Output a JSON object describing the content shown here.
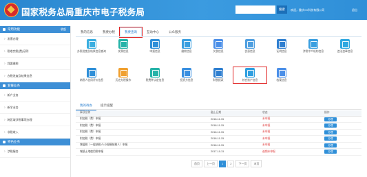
{
  "header": {
    "title": "国家税务总局重庆市电子税务局",
    "search_placeholder": "",
    "search_button": "搜索",
    "welcome": "欢迎，重庆XX科技有限公司",
    "logout": "退出"
  },
  "sidebar": {
    "groups": [
      {
        "label": "常用功能",
        "action": "收起",
        "items": [
          "发票办理",
          "税收完税(费)证明",
          "我要缴税",
          "办税进度及结果信息"
        ]
      },
      {
        "label": "套餐业务",
        "action": "",
        "items": [
          "新户业务",
          "新学业务",
          "跨区域涉税事项办理",
          "非税收入"
        ]
      },
      {
        "label": "特色业务",
        "action": "",
        "items": [
          "涉税服务"
        ]
      }
    ]
  },
  "topnav": {
    "tabs": [
      "我的信息",
      "我要办税",
      "我要查询",
      "互动中心",
      "公众服务"
    ],
    "active_index": 2
  },
  "grid": {
    "items": [
      {
        "label": "办税进度及结果信息查询",
        "color": "#3aaee0"
      },
      {
        "label": "发票信息",
        "color": "#26b3a8"
      },
      {
        "label": "申报信息",
        "color": "#2f8fd8"
      },
      {
        "label": "缴款信息",
        "color": "#3a9fe0"
      },
      {
        "label": "欠税信息",
        "color": "#4b8fe8"
      },
      {
        "label": "优惠信息",
        "color": "#4f9fe0"
      },
      {
        "label": "证明信息",
        "color": "#2f7fd0"
      },
      {
        "label": "涉税中介机构信息",
        "color": "#3a9fe0"
      },
      {
        "label": "违法违章信息",
        "color": "#2fa8e0"
      },
      {
        "label": "纳税人信用评价信息",
        "color": "#2f8fd8"
      },
      {
        "label": "历史办税操作",
        "color": "#f0a030"
      },
      {
        "label": "税费种认定信息",
        "color": "#26b3a8"
      },
      {
        "label": "投资方信息",
        "color": "#3a8fe0"
      },
      {
        "label": "财税报表",
        "color": "#2f7fd0"
      },
      {
        "label": "综合账户信息",
        "color": "#2f9fe0"
      },
      {
        "label": "档案信息",
        "color": "#4b8fe8"
      }
    ]
  },
  "lowtabs": {
    "tabs": [
      "我的待办",
      "提示提醒"
    ],
    "active_index": 0
  },
  "table": {
    "headers": [
      "事项名称",
      "截止日期",
      "状态",
      "操作"
    ],
    "rows": [
      {
        "name": "附加税（费）申报",
        "date": "2018-11-15",
        "status": "未申报",
        "action": "办理"
      },
      {
        "name": "附加税（费）申报",
        "date": "2018-11-15",
        "status": "未申报",
        "action": "办理"
      },
      {
        "name": "附加税（费）申报",
        "date": "2018-11-15",
        "status": "未申报",
        "action": "办理"
      },
      {
        "name": "附加税（费）申报",
        "date": "2018-11-15",
        "status": "未申报",
        "action": "办理"
      },
      {
        "name": "增值税（一般纳税人/小规模纳税人）申报",
        "date": "2018-11-15",
        "status": "未申报",
        "action": "办理"
      },
      {
        "name": "城镇土地使用税申报",
        "date": "2017-10-31",
        "status": "逾期未申报",
        "action": "办理"
      }
    ]
  },
  "pager": {
    "first": "首页",
    "prev": "上一页",
    "pages": [
      "1",
      "2"
    ],
    "current": "1",
    "next": "下一页",
    "last": "末页"
  }
}
